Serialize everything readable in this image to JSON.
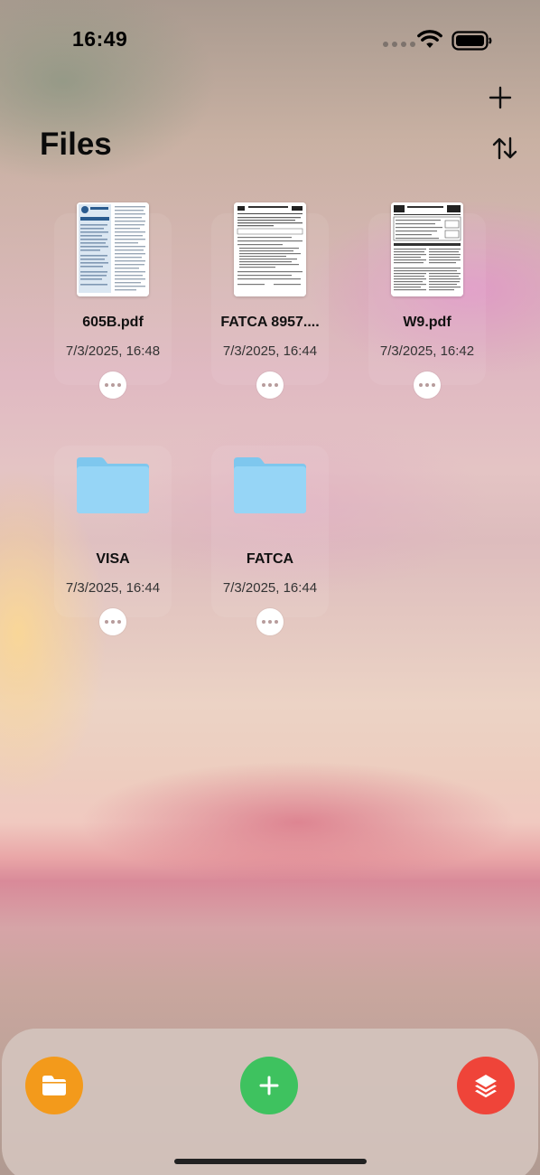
{
  "status_bar": {
    "time": "16:49"
  },
  "header": {
    "title": "Files"
  },
  "items": [
    {
      "type": "file",
      "name": "605B.pdf",
      "date": "7/3/2025, 16:48"
    },
    {
      "type": "file",
      "name": "FATCA 8957....",
      "date": "7/3/2025, 16:44"
    },
    {
      "type": "file",
      "name": "W9.pdf",
      "date": "7/3/2025, 16:42"
    },
    {
      "type": "folder",
      "name": "VISA",
      "date": "7/3/2025, 16:44"
    },
    {
      "type": "folder",
      "name": "FATCA",
      "date": "7/3/2025, 16:44"
    }
  ],
  "icons": {
    "top_right": [
      "plus-icon",
      "sort-arrows-icon"
    ],
    "item_actions": "more-ellipsis-icon",
    "tab_bar": [
      "folder-icon",
      "plus-icon",
      "layers-icon"
    ]
  },
  "colors": {
    "tab_files": "#f39a1b",
    "tab_add": "#3ec25f",
    "tab_stack": "#ef4439",
    "folder": "#8fd1f3"
  }
}
